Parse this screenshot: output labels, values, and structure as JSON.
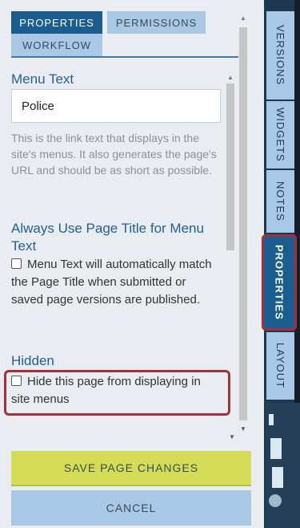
{
  "tabs": [
    {
      "label": "PROPERTIES",
      "active": true
    },
    {
      "label": "PERMISSIONS",
      "active": false
    },
    {
      "label": "WORKFLOW",
      "active": false
    }
  ],
  "menu_text": {
    "heading": "Menu Text",
    "value": "Police",
    "help": "This is the link text that displays in the site's menus. It also generates the page's URL and should be as short as possible."
  },
  "always_use_title": {
    "heading": "Always Use Page Title for Menu Text",
    "checkbox_label": "Menu Text will automatically match the Page Title when submitted or saved page versions are published.",
    "checked": false
  },
  "hidden": {
    "heading": "Hidden",
    "checkbox_label": "Hide this page from displaying in site menus",
    "checked": false
  },
  "buttons": {
    "save": "SAVE PAGE CHANGES",
    "cancel": "CANCEL"
  },
  "side_tabs": [
    {
      "label": "VERSIONS",
      "active": false
    },
    {
      "label": "WIDGETS",
      "active": false
    },
    {
      "label": "NOTES",
      "active": false
    },
    {
      "label": "PROPERTIES",
      "active": true
    },
    {
      "label": "LAYOUT",
      "active": false
    }
  ],
  "colors": {
    "accent": "#1c5d8f",
    "tab_inactive": "#a9c8e6",
    "save_button": "#d5dd58",
    "highlight": "#a2303d"
  }
}
